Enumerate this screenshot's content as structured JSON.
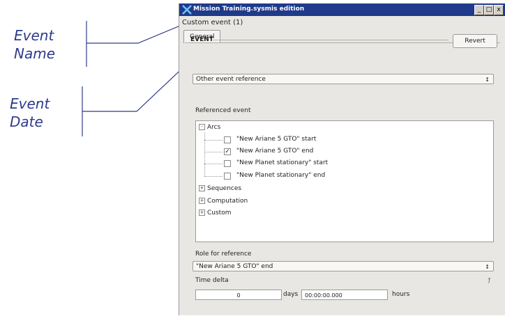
{
  "annotations": {
    "event_name": [
      "Event",
      "Name"
    ],
    "event_date": [
      "Event",
      "Date"
    ]
  },
  "window": {
    "title": "Mission Training.sysmis edition",
    "min": "_",
    "max": "□",
    "close": "x"
  },
  "breadcrumb": "Custom event (1)",
  "tabs": [
    {
      "label": "General"
    }
  ],
  "section": {
    "title": "EVENT",
    "revert_label": "Revert"
  },
  "event_type_select": {
    "value": "Other event reference"
  },
  "referenced_event": {
    "label": "Referenced event",
    "tree": {
      "arcs": {
        "label": "Arcs",
        "expander": "-",
        "children": [
          {
            "label": "\"New Ariane 5 GTO\" start",
            "checked": false
          },
          {
            "label": "\"New Ariane 5 GTO\" end",
            "checked": true
          },
          {
            "label": "\"New Planet stationary\" start",
            "checked": false
          },
          {
            "label": "\"New Planet stationary\" end",
            "checked": false
          }
        ]
      },
      "others": [
        {
          "label": "Sequences",
          "expander": "+"
        },
        {
          "label": "Computation",
          "expander": "+"
        },
        {
          "label": "Custom",
          "expander": "+"
        }
      ]
    }
  },
  "role_for_reference": {
    "label": "Role for reference",
    "value": "\"New Ariane 5 GTO\" end"
  },
  "time_delta": {
    "label": "Time delta",
    "days_value": "0",
    "days_unit": "days",
    "hours_value": "00:00:00.000",
    "hours_unit": "hours"
  }
}
